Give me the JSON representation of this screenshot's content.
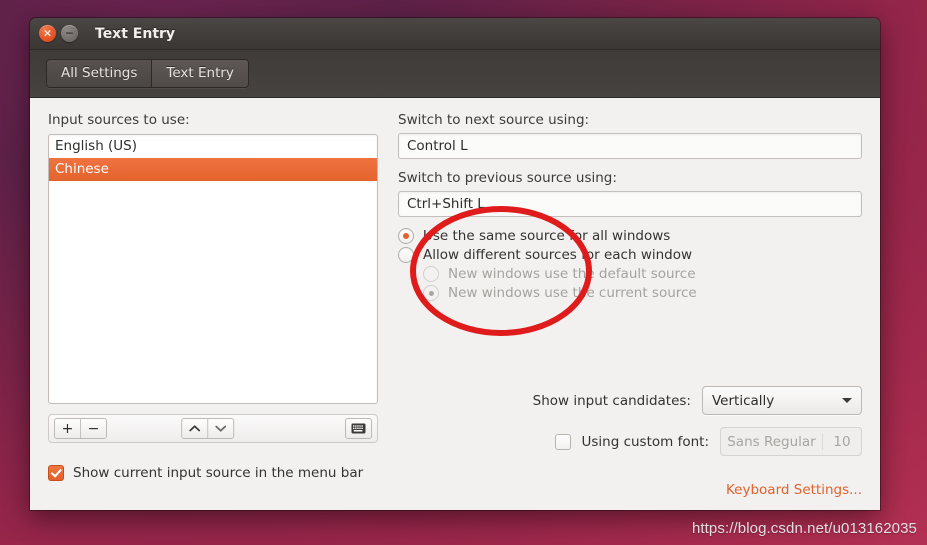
{
  "window": {
    "title": "Text Entry",
    "close_icon": "close-icon",
    "close_glyph": "×",
    "minimize_icon": "minimize-icon",
    "minimize_glyph": "−"
  },
  "tabs": [
    {
      "label": "All Settings",
      "active": false
    },
    {
      "label": "Text Entry",
      "active": true
    }
  ],
  "left": {
    "sources_label": "Input sources to use:",
    "sources": [
      {
        "label": "English (US)",
        "selected": false
      },
      {
        "label": "Chinese",
        "selected": true
      }
    ],
    "toolbar": {
      "add_label": "+",
      "remove_label": "−",
      "move_up_icon": "chevron-up-icon",
      "move_down_icon": "chevron-down-icon",
      "keyboard_icon": "keyboard-icon"
    },
    "menubar_checkbox": {
      "label": "Show current input source in the menu bar",
      "checked": true
    }
  },
  "right": {
    "next_source_label": "Switch to next source using:",
    "next_source_value": "Control L",
    "prev_source_label": "Switch to previous source using:",
    "prev_source_value": "Ctrl+Shift L",
    "radios": [
      {
        "label": "Use the same source for all windows",
        "selected": true,
        "disabled": false,
        "indent": false
      },
      {
        "label": "Allow different sources for each window",
        "selected": false,
        "disabled": false,
        "indent": false
      },
      {
        "label": "New windows use the default source",
        "selected": false,
        "disabled": true,
        "indent": true
      },
      {
        "label": "New windows use the current source",
        "selected": true,
        "disabled": true,
        "indent": true
      }
    ],
    "candidates_label": "Show input candidates:",
    "candidates_value": "Vertically",
    "custom_font_label": "Using custom font:",
    "custom_font_checked": false,
    "font_name": "Sans Regular",
    "font_size": "10",
    "keyboard_settings_link": "Keyboard Settings..."
  },
  "annotation": {
    "type": "ellipse",
    "color": "#e01b1b"
  },
  "watermark": "https://blog.csdn.net/u013162035",
  "colors": {
    "accent_orange": "#e2602b",
    "selection_orange": "#e76a33",
    "link_orange": "#e2622c",
    "annotation_red": "#e01b1b",
    "window_bg": "#f2f1f0",
    "titlebar": "#413d3b"
  }
}
